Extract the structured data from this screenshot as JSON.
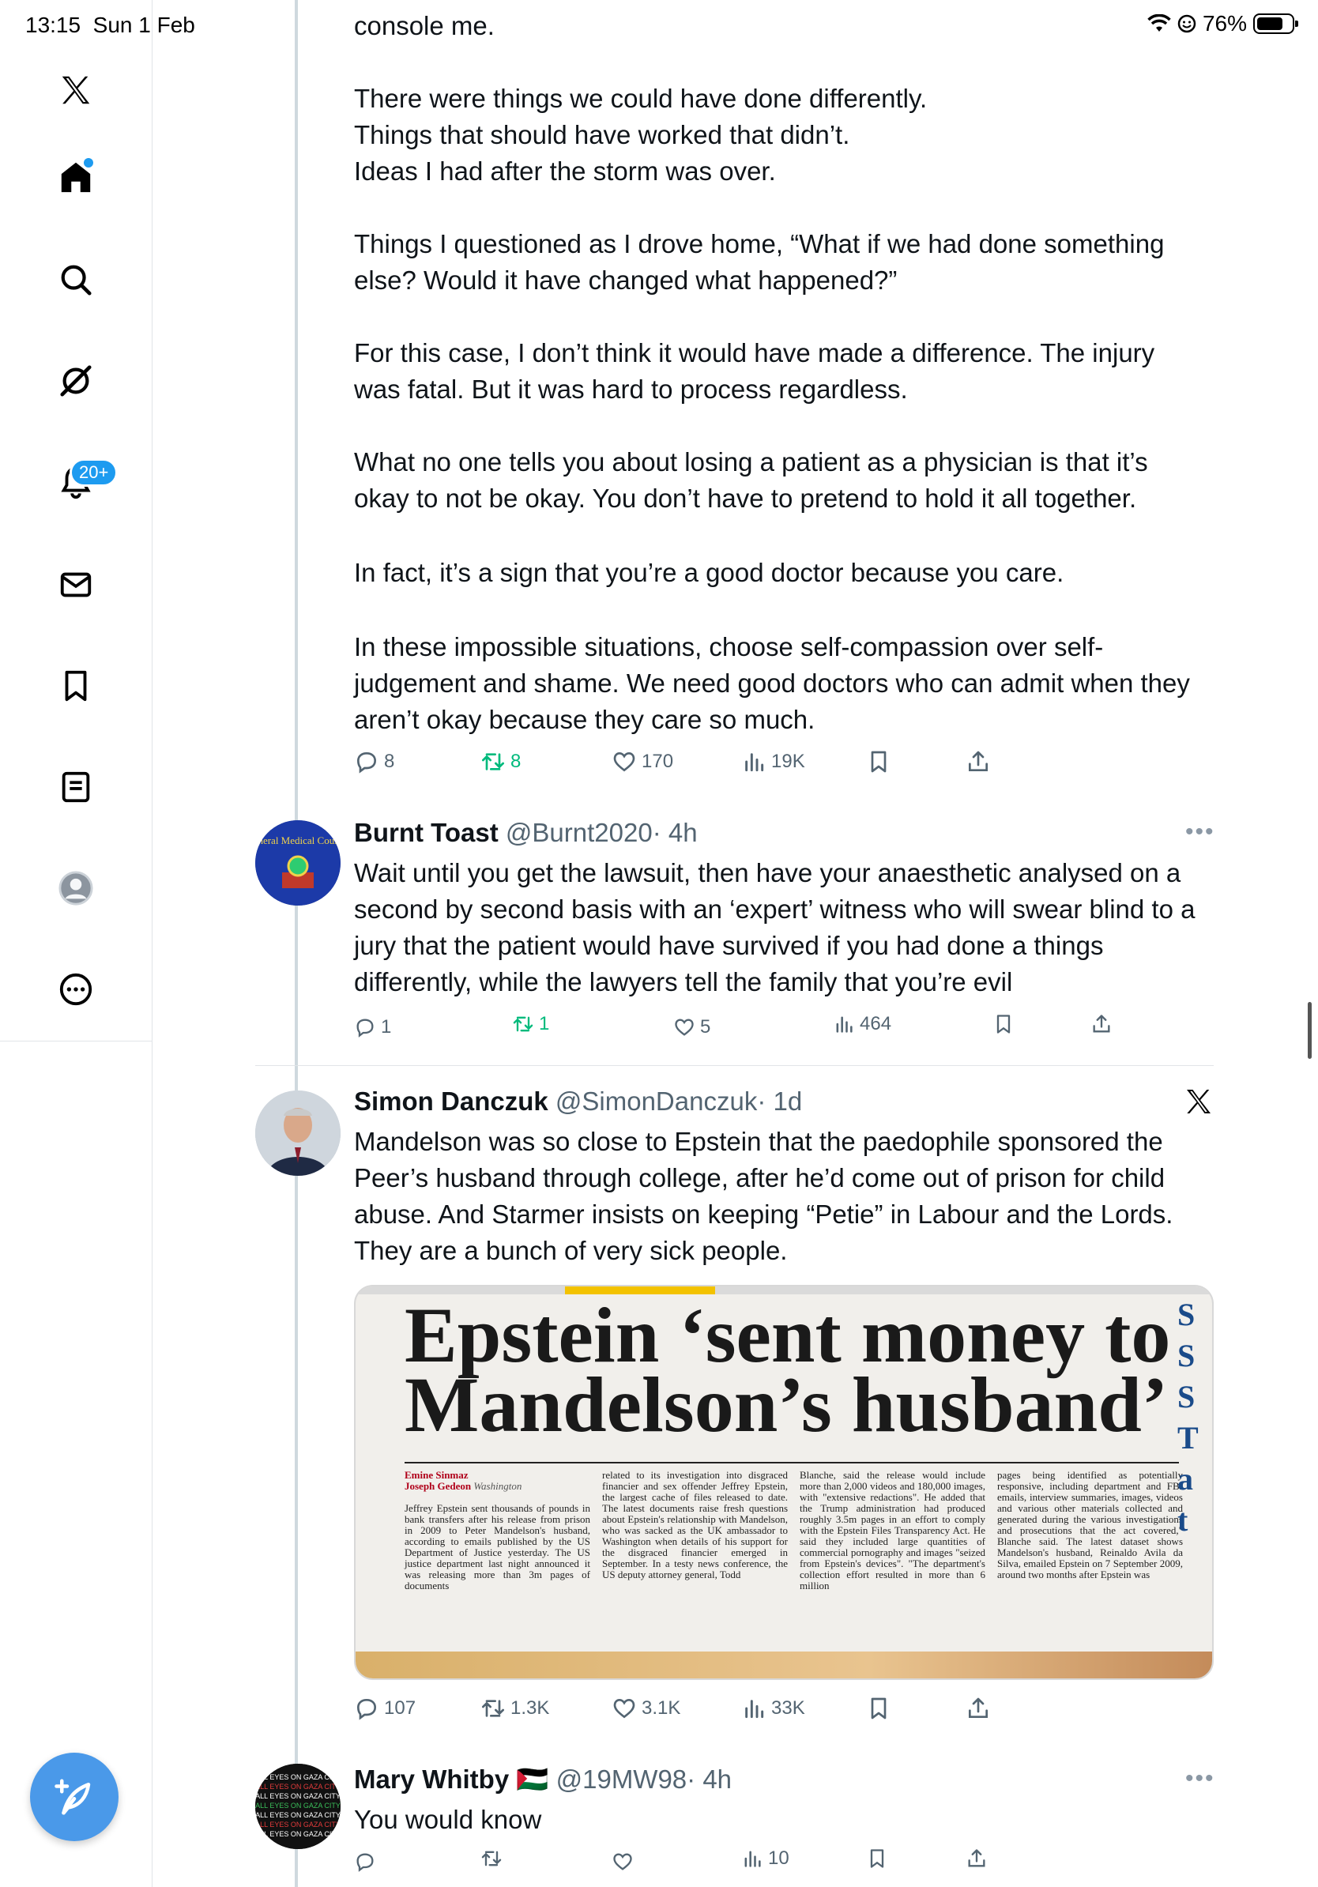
{
  "status_bar": {
    "time": "13:15",
    "date": "Sun 1 Feb",
    "battery": "76%",
    "battery_level": 0.76
  },
  "sidebar": {
    "items": [
      {
        "name": "x-logo-icon"
      },
      {
        "name": "home-icon",
        "active": true
      },
      {
        "name": "search-icon"
      },
      {
        "name": "grok-icon"
      },
      {
        "name": "notifications-icon",
        "badge": "20+"
      },
      {
        "name": "messages-icon"
      },
      {
        "name": "bookmarks-icon"
      },
      {
        "name": "lists-icon"
      },
      {
        "name": "profile-icon"
      },
      {
        "name": "more-icon"
      }
    ]
  },
  "main_tweet": {
    "first_line": "console me.",
    "paragraphs": [
      "There were things we could have done differently.\nThings that should have worked that didn’t.\nIdeas I had after the storm was over.",
      "Things I questioned as I drove home, “What if we had done something else? Would it have changed what happened?”",
      "For this case, I don’t think it would have made a difference. The injury was fatal. But it was hard to process regardless.",
      "What no one tells you about losing a patient as a physician is that it’s okay to not be okay. You don’t have to pretend to hold it all together.",
      "In fact, it’s a sign that you’re a good doctor because you care.",
      "In these impossible situations, choose self-compassion over self-judgement and shame. We need good doctors who can admit when they aren’t okay because they care so much."
    ],
    "stats": {
      "replies": "8",
      "reposts": "8",
      "likes": "170",
      "views": "19K"
    }
  },
  "replies": [
    {
      "name": "Burnt Toast",
      "handle": "@Burnt2020",
      "time": "· 4h",
      "avatar_text": "General Medical Council",
      "text": "Wait until you get the lawsuit, then have your anaesthetic analysed on a second by second basis with an ‘expert’ witness who will swear blind to a jury that the patient would have survived if you had done a things differently, while the lawyers tell the family that you’re evil",
      "stats": {
        "replies": "1",
        "reposts": "1",
        "likes": "5",
        "views": "464"
      }
    },
    {
      "name": "Simon Danczuk",
      "handle": "@SimonDanczuk",
      "time": "· 1d",
      "text": "Mandelson was so close to Epstein that the paedophile sponsored the Peer’s husband through college, after he’d come out of prison for child abuse. And Starmer insists on keeping “Petie” in Labour and the Lords. They are a bunch of very sick people.",
      "image": {
        "headline_line1": "Epstein ‘sent money to",
        "headline_line2": "Mandelson’s husband’",
        "byline_author1": "Emine Sinmaz",
        "byline_author2": "Joseph Gedeon",
        "byline_place": "Washington",
        "col1": "Jeffrey Epstein sent thousands of pounds in bank transfers after his release from prison in 2009 to Peter Mandelson's husband, according to emails published by the US Department of Justice yesterday. The US justice department last night announced it was releasing more than 3m pages of documents",
        "col2": "related to its investigation into disgraced financier and sex offender Jeffrey Epstein, the largest cache of files released to date. The latest documents raise fresh questions about Epstein's relationship with Mandelson, who was sacked as the UK ambassador to Washington when details of his support for the disgraced financier emerged in September. In a testy news conference, the US deputy attorney general, Todd",
        "col3": "Blanche, said the release would include more than 2,000 videos and 180,000 images, with \"extensive redactions\". He added that the Trump administration had produced roughly 3.5m pages in an effort to comply with the Epstein Files Transparency Act. He said they included large quantities of commercial pornography and images \"seized from Epstein's devices\". \"The department's collection effort resulted in more than 6 million",
        "col4": "pages being identified as potentially responsive, including department and FBI emails, interview summaries, images, videos and various other materials collected and generated during the various investigations and prosecutions that the act covered,\" Blanche said. The latest dataset shows Mandelson's husband, Reinaldo Avila da Silva, emailed Epstein on 7 September 2009, around two months after Epstein was"
      },
      "stats": {
        "replies": "107",
        "reposts": "1.3K",
        "likes": "3.1K",
        "views": "33K"
      }
    },
    {
      "name": "Mary Whitby 🇵🇸",
      "handle": "@19MW98",
      "time": "· 4h",
      "avatar_text": "ALL EYES ON GAZA CITY",
      "text": "You would know",
      "stats": {
        "replies": "",
        "reposts": "",
        "likes": "",
        "views": "10"
      }
    }
  ],
  "colors": {
    "accent": "#1d9bf0",
    "repost_green": "#00ba7c",
    "secondary_text": "#536471"
  }
}
